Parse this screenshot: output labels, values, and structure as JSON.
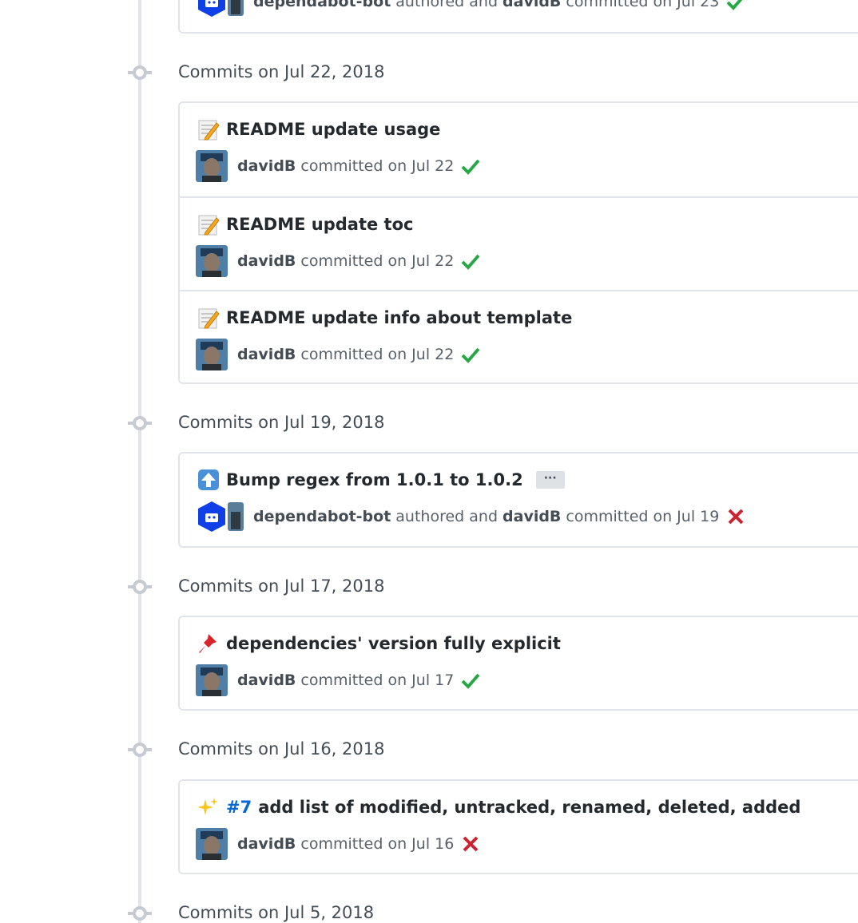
{
  "colors": {
    "timeline": "#e1e4e8",
    "success": "#28a745",
    "failure": "#cb2431",
    "link": "#0366d6",
    "bot_badge": "#0f3fe6"
  },
  "partial_top": {
    "author": "dependabot-bot",
    "authored_text": "authored and",
    "committer": "davidB",
    "committed_text": "committed on Jul 23",
    "status": "success"
  },
  "groups": [
    {
      "title": "Commits on Jul 22, 2018",
      "commits": [
        {
          "emoji": "memo-icon",
          "title": "README update usage",
          "author": "davidB",
          "meta": "committed on Jul 22",
          "status": "success"
        },
        {
          "emoji": "memo-icon",
          "title": "README update toc",
          "author": "davidB",
          "meta": "committed on Jul 22",
          "status": "success"
        },
        {
          "emoji": "memo-icon",
          "title": "README update info about template",
          "author": "davidB",
          "meta": "committed on Jul 22",
          "status": "success"
        }
      ]
    },
    {
      "title": "Commits on Jul 19, 2018",
      "commits": [
        {
          "emoji": "arrow-up-icon",
          "title": "Bump regex from 1.0.1 to 1.0.2",
          "ellipsis": "···",
          "author": "dependabot-bot",
          "authored_text": "authored and",
          "committer": "davidB",
          "meta": "committed on Jul 19",
          "status": "failure"
        }
      ]
    },
    {
      "title": "Commits on Jul 17, 2018",
      "commits": [
        {
          "emoji": "pushpin-icon",
          "title": "dependencies' version fully explicit",
          "author": "davidB",
          "meta": "committed on Jul 17",
          "status": "success"
        }
      ]
    },
    {
      "title": "Commits on Jul 16, 2018",
      "commits": [
        {
          "emoji": "sparkles-icon",
          "issue": "#7",
          "title": "add list of modified, untracked, renamed, deleted, added",
          "author": "davidB",
          "meta": "committed on Jul 16",
          "status": "failure"
        }
      ]
    },
    {
      "title": "Commits on Jul 5, 2018",
      "commits": []
    }
  ]
}
